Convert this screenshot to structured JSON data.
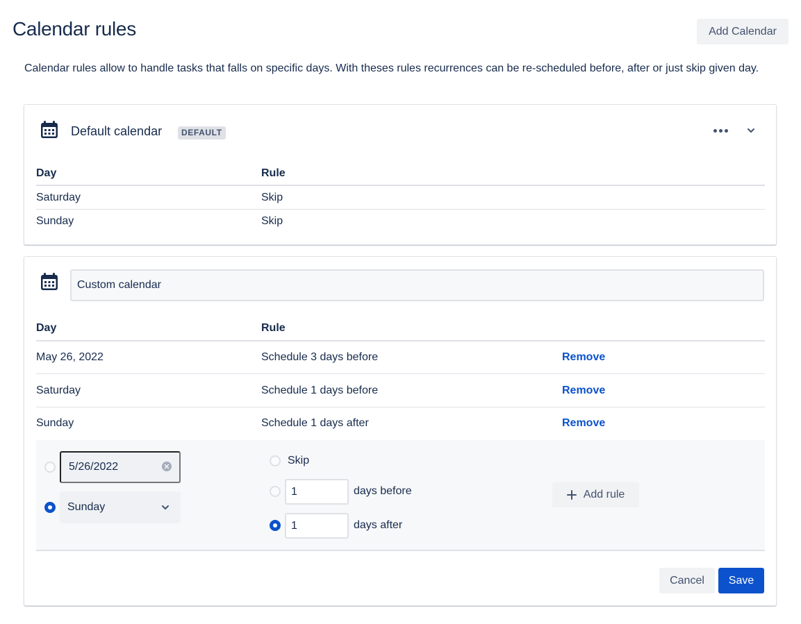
{
  "page": {
    "title": "Calendar rules",
    "add_calendar_label": "Add Calendar",
    "description": "Calendar rules allow to handle tasks that falls on specific days. With theses rules recurrences can be re-scheduled before, after or just skip given day."
  },
  "default_calendar": {
    "name": "Default calendar",
    "badge": "DEFAULT",
    "columns": {
      "day": "Day",
      "rule": "Rule"
    },
    "rows": [
      {
        "day": "Saturday",
        "rule": "Skip"
      },
      {
        "day": "Sunday",
        "rule": "Skip"
      }
    ]
  },
  "custom_calendar": {
    "name_value": "Custom calendar",
    "columns": {
      "day": "Day",
      "rule": "Rule"
    },
    "rows": [
      {
        "day": "May 26, 2022",
        "rule": "Schedule 3 days before",
        "action": "Remove"
      },
      {
        "day": "Saturday",
        "rule": "Schedule 1 days before",
        "action": "Remove"
      },
      {
        "day": "Sunday",
        "rule": "Schedule 1 days after",
        "action": "Remove"
      }
    ],
    "editor": {
      "date_value": "5/26/2022",
      "weekday_value": "Sunday",
      "day_selection": "weekday",
      "rule_selection": "after",
      "skip_label": "Skip",
      "before_value": "1",
      "before_label": "days before",
      "after_value": "1",
      "after_label": "days after",
      "add_rule_label": "Add rule"
    },
    "cancel_label": "Cancel",
    "save_label": "Save"
  },
  "icons": {
    "calendar": "calendar-icon",
    "more": "more-horizontal-icon",
    "collapse": "chevron-down-icon",
    "clear": "clear-circle-icon",
    "add": "plus-icon"
  },
  "colors": {
    "primary": "#0c52cc",
    "text": "#172b4d",
    "border": "#dfe1e6",
    "neutral_button": "#f1f2f4"
  }
}
